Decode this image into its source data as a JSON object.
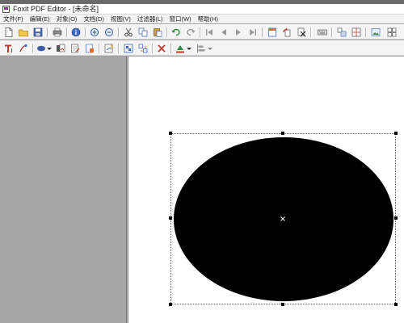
{
  "window": {
    "title": "Foxit PDF Editor - [未命名]"
  },
  "menu": [
    "文件(F)",
    "编辑(E)",
    "对象(O)",
    "文档(D)",
    "视图(V)",
    "过滤器(L)",
    "窗口(W)",
    "帮助(H)"
  ],
  "toolbar1": {
    "icons": [
      "new-document-icon",
      "open-folder-icon",
      "save-disk-icon",
      "print-icon",
      "info-icon",
      "zoom-in-icon",
      "zoom-out-icon",
      "cut-icon",
      "copy-icon",
      "paste-icon",
      "undo-icon",
      "redo-icon",
      "first-page-icon",
      "previous-page-icon",
      "next-page-icon",
      "last-page-icon",
      "page-thumbnail-icon",
      "rotate-icon",
      "delete-page-icon",
      "keyboard-icon",
      "arrange-icon",
      "split-icon",
      "image-icon"
    ]
  },
  "toolbar2": {
    "icons": [
      "text-tool-icon",
      "brush-tool-icon",
      "ellipse-tool-icon",
      "dropdown-icon",
      "image-insert-icon",
      "edit-page-icon",
      "document-properties-icon",
      "sign-icon",
      "group-icon",
      "ungroup-icon",
      "remove-object-icon",
      "fill-color-icon",
      "dropdown-icon",
      "align-icon",
      "dropdown-icon"
    ]
  },
  "colors": {
    "app_accent": "#8b2b8f",
    "shape_fill": "#000000",
    "page_background": "#ffffff",
    "panel_background": "#a6a6a6"
  }
}
